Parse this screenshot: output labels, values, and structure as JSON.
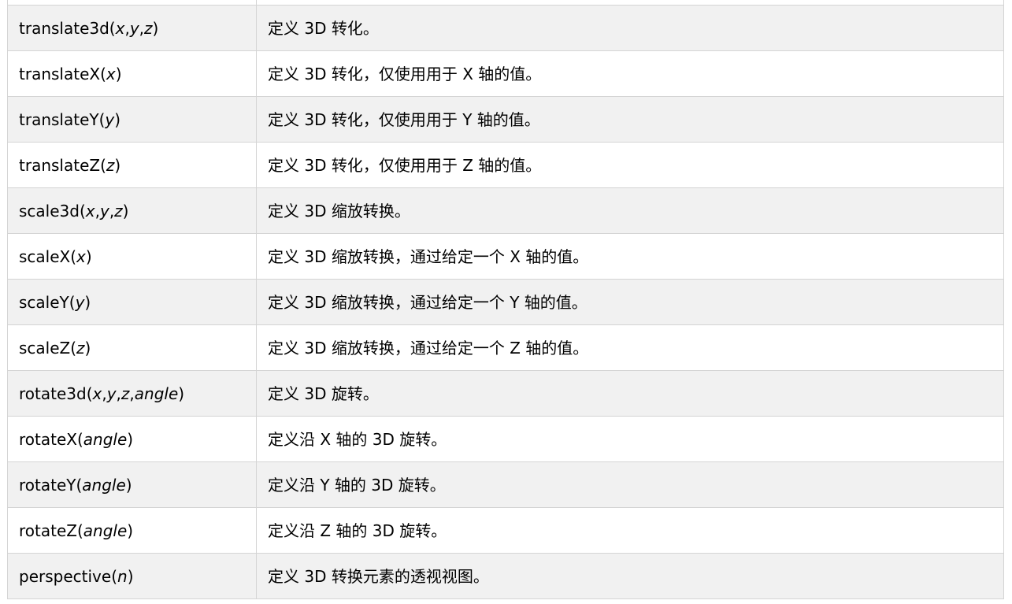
{
  "table": {
    "rows": [
      {
        "name": "",
        "args": [],
        "desc": ""
      },
      {
        "name": "translate3d",
        "args": [
          "x",
          "y",
          "z"
        ],
        "desc": "定义 3D 转化。"
      },
      {
        "name": "translateX",
        "args": [
          "x"
        ],
        "desc": "定义 3D 转化，仅使用用于 X 轴的值。"
      },
      {
        "name": "translateY",
        "args": [
          "y"
        ],
        "desc": "定义 3D 转化，仅使用用于 Y 轴的值。"
      },
      {
        "name": "translateZ",
        "args": [
          "z"
        ],
        "desc": "定义 3D 转化，仅使用用于 Z 轴的值。"
      },
      {
        "name": "scale3d",
        "args": [
          "x",
          "y",
          "z"
        ],
        "desc": "定义 3D 缩放转换。"
      },
      {
        "name": "scaleX",
        "args": [
          "x"
        ],
        "desc": "定义 3D 缩放转换，通过给定一个 X 轴的值。"
      },
      {
        "name": "scaleY",
        "args": [
          "y"
        ],
        "desc": "定义 3D 缩放转换，通过给定一个 Y 轴的值。"
      },
      {
        "name": "scaleZ",
        "args": [
          "z"
        ],
        "desc": "定义 3D 缩放转换，通过给定一个 Z 轴的值。"
      },
      {
        "name": "rotate3d",
        "args": [
          "x",
          "y",
          "z",
          "angle"
        ],
        "desc": "定义 3D 旋转。"
      },
      {
        "name": "rotateX",
        "args": [
          "angle"
        ],
        "desc": "定义沿 X 轴的 3D 旋转。"
      },
      {
        "name": "rotateY",
        "args": [
          "angle"
        ],
        "desc": "定义沿 Y 轴的 3D 旋转。"
      },
      {
        "name": "rotateZ",
        "args": [
          "angle"
        ],
        "desc": "定义沿 Z 轴的 3D 旋转。"
      },
      {
        "name": "perspective",
        "args": [
          "n"
        ],
        "desc": "定义 3D 转换元素的透视视图。"
      }
    ]
  }
}
